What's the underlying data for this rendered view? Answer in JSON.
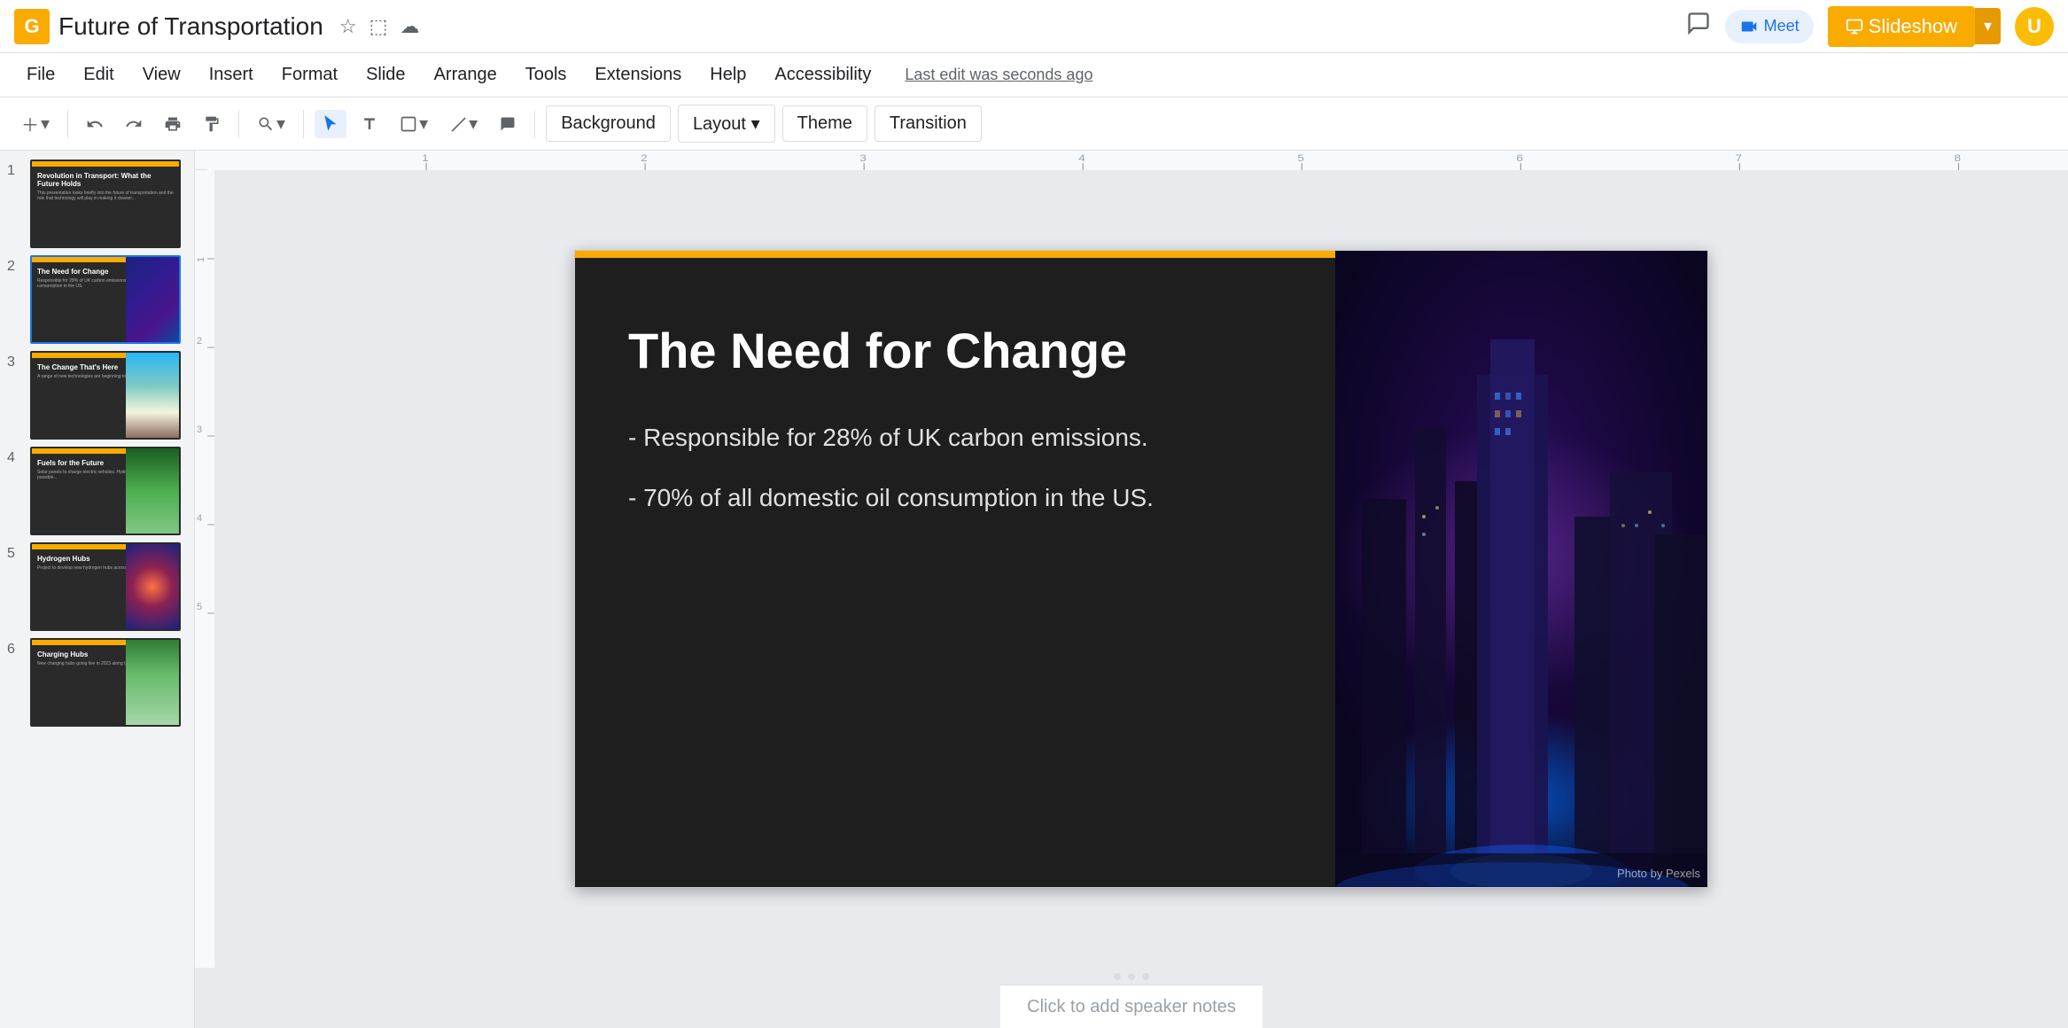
{
  "app": {
    "logo_letter": "G",
    "title": "Future of Transportation",
    "title_icons": [
      "★",
      "⬚",
      "☁"
    ],
    "last_edit": "Last edit was seconds ago"
  },
  "header": {
    "slideshow_label": "Slideshow",
    "comment_icon": "💬",
    "meet_icon": "📹",
    "meet_label": "Meet"
  },
  "menu": {
    "items": [
      {
        "label": "File"
      },
      {
        "label": "Edit"
      },
      {
        "label": "View"
      },
      {
        "label": "Insert"
      },
      {
        "label": "Format"
      },
      {
        "label": "Slide"
      },
      {
        "label": "Arrange"
      },
      {
        "label": "Tools"
      },
      {
        "label": "Extensions"
      },
      {
        "label": "Help"
      },
      {
        "label": "Accessibility"
      }
    ]
  },
  "toolbar": {
    "bg_label": "Background",
    "layout_label": "Layout",
    "layout_arrow": "▾",
    "theme_label": "Theme",
    "transition_label": "Transition"
  },
  "slides": [
    {
      "number": "1",
      "title_short": "Revolution in Transport: What the Future Holds",
      "body_short": "This presentation looks briefly into...",
      "has_city": false
    },
    {
      "number": "2",
      "title_short": "The Need for Change",
      "body_short": "Responsible for 28% of UK carbon emissions...",
      "has_city": true,
      "selected": true
    },
    {
      "number": "3",
      "title_short": "The Change That's Here",
      "body_short": "A range of new technologies...",
      "has_beach": true
    },
    {
      "number": "4",
      "title_short": "Fuels for the Future",
      "body_short": "Solar panels to charge electric...",
      "has_green": true
    },
    {
      "number": "5",
      "title_short": "Hydrogen Hubs",
      "body_short": "Project to develop new hydrogen...",
      "has_galaxy": true
    },
    {
      "number": "6",
      "title_short": "Charging Hubs",
      "body_short": "New charging hubs going live in 2023...",
      "has_green2": true
    }
  ],
  "slide_content": {
    "heading": "The Need for Change",
    "bullets": [
      "- Responsible for 28% of UK carbon emissions.",
      "- 70% of all domestic oil consumption in the US."
    ],
    "photo_credit": "Photo by Pexels"
  },
  "speaker_notes": {
    "placeholder": "Click to add speaker notes"
  }
}
